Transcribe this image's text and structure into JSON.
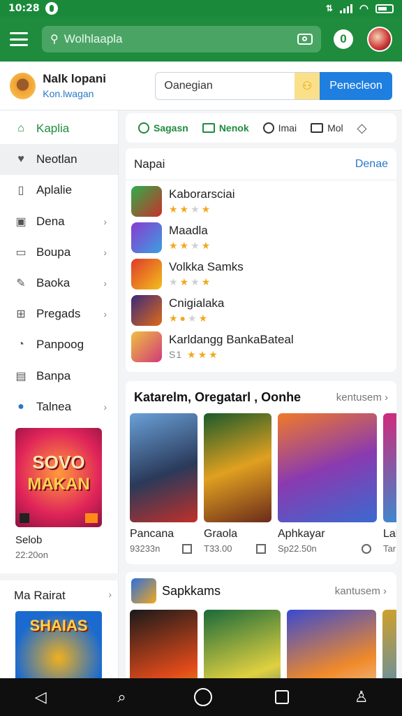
{
  "status_bar": {
    "time": "10:28"
  },
  "app_bar": {
    "search_placeholder": "Wolhlaapla",
    "badge_count": "0"
  },
  "profile": {
    "name": "Nalk lopani",
    "subtitle": "Kon.lwagan",
    "field_value": "Oanegian",
    "button_label": "Penecleon"
  },
  "sidebar": {
    "items": [
      {
        "label": "Kaplia",
        "icon": "home-icon"
      },
      {
        "label": "Neotlan",
        "icon": "heart-icon"
      },
      {
        "label": "Aplalie",
        "icon": "document-icon"
      },
      {
        "label": "Dena",
        "icon": "box-icon"
      },
      {
        "label": "Boupa",
        "icon": "folder-icon"
      },
      {
        "label": "Baoka",
        "icon": "pen-icon"
      },
      {
        "label": "Pregads",
        "icon": "puzzle-icon"
      },
      {
        "label": "Panpoog",
        "icon": "chat-icon"
      },
      {
        "label": "Banpa",
        "icon": "bag-icon"
      },
      {
        "label": "Talnea",
        "icon": "pin-icon"
      }
    ],
    "promo": {
      "title_line1": "SOVO",
      "title_line2": "MAKAN",
      "caption": "Selob",
      "size": "22:20on"
    },
    "section2_title": "Ma Rairat",
    "promo2_title": "SHAIAS"
  },
  "chips": [
    {
      "label": "Sagasn",
      "icon": "chat-icon"
    },
    {
      "label": "Nenok",
      "icon": "shield-icon"
    },
    {
      "label": "Imai",
      "icon": "clock-icon"
    },
    {
      "label": "Mol",
      "icon": "screen-icon"
    }
  ],
  "list_card": {
    "title": "Napai",
    "more": "Denae",
    "rows": [
      {
        "name": "Kaborarsciai",
        "rating": 3
      },
      {
        "name": "Maadla",
        "rating": 2
      },
      {
        "name": "Volkka Samks",
        "rating": 3
      },
      {
        "name": "Cnigialaka",
        "rating": 2
      },
      {
        "name": "Karldangg BankaBateal",
        "rating_label": "S1",
        "rating": 3
      }
    ]
  },
  "featured": {
    "title": "Katarelm, Oregatarl , Oonhe",
    "more": "kentusem",
    "tiles": [
      {
        "name": "Pancana",
        "size": "93233n"
      },
      {
        "name": "Graola",
        "size": "T33.00"
      },
      {
        "name": "Aphkayar",
        "size": "Sp22.50n"
      },
      {
        "name": "Lal",
        "size": "Tar"
      }
    ]
  },
  "second_section": {
    "title": "Sapkkams",
    "more": "kantusem"
  },
  "colors": {
    "primary": "#1e8c3c",
    "accent": "#1f7fe0",
    "star": "#f2a81c"
  }
}
